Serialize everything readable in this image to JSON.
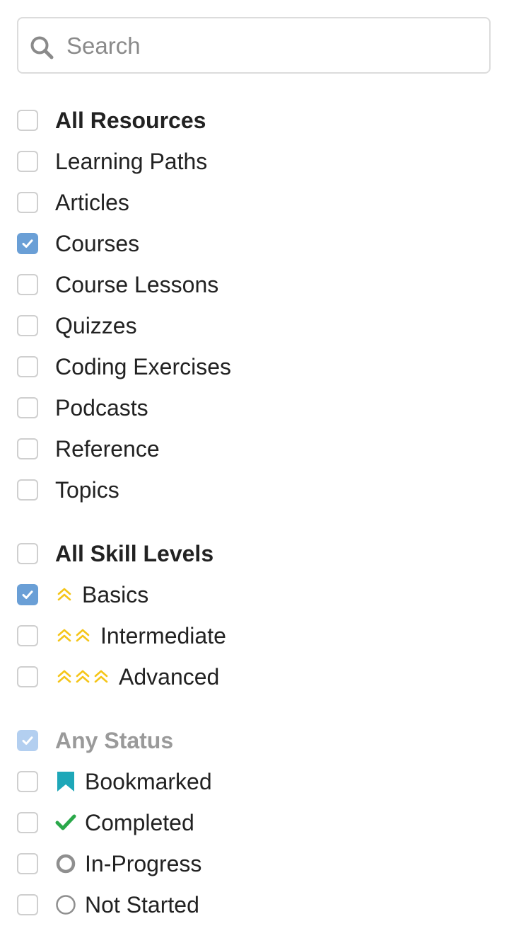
{
  "search": {
    "placeholder": "Search",
    "value": ""
  },
  "resources": {
    "items": [
      {
        "label": "All Resources",
        "checked": false,
        "bold": true
      },
      {
        "label": "Learning Paths",
        "checked": false
      },
      {
        "label": "Articles",
        "checked": false
      },
      {
        "label": "Courses",
        "checked": true
      },
      {
        "label": "Course Lessons",
        "checked": false
      },
      {
        "label": "Quizzes",
        "checked": false
      },
      {
        "label": "Coding Exercises",
        "checked": false
      },
      {
        "label": "Podcasts",
        "checked": false
      },
      {
        "label": "Reference",
        "checked": false
      },
      {
        "label": "Topics",
        "checked": false
      }
    ]
  },
  "skill_levels": {
    "items": [
      {
        "label": "All Skill Levels",
        "checked": false,
        "bold": true
      },
      {
        "label": "Basics",
        "checked": true,
        "icon": "chevron-up-single-icon"
      },
      {
        "label": "Intermediate",
        "checked": false,
        "icon": "chevron-up-double-icon"
      },
      {
        "label": "Advanced",
        "checked": false,
        "icon": "chevron-up-triple-icon"
      }
    ]
  },
  "status": {
    "items": [
      {
        "label": "Any Status",
        "checked": true,
        "disabled": true,
        "bold": true
      },
      {
        "label": "Bookmarked",
        "checked": false,
        "icon": "bookmark-icon"
      },
      {
        "label": "Completed",
        "checked": false,
        "icon": "checkmark-icon"
      },
      {
        "label": "In-Progress",
        "checked": false,
        "icon": "ring-icon"
      },
      {
        "label": "Not Started",
        "checked": false,
        "icon": "circle-outline-icon"
      }
    ]
  },
  "colors": {
    "checkbox_checked": "#6a9fd6",
    "checkbox_checked_disabled": "#b3cff0",
    "level_chevron": "#f5c518",
    "bookmark": "#1ea7b8",
    "completed": "#2aa84a",
    "in_progress": "#8f8f8f"
  }
}
